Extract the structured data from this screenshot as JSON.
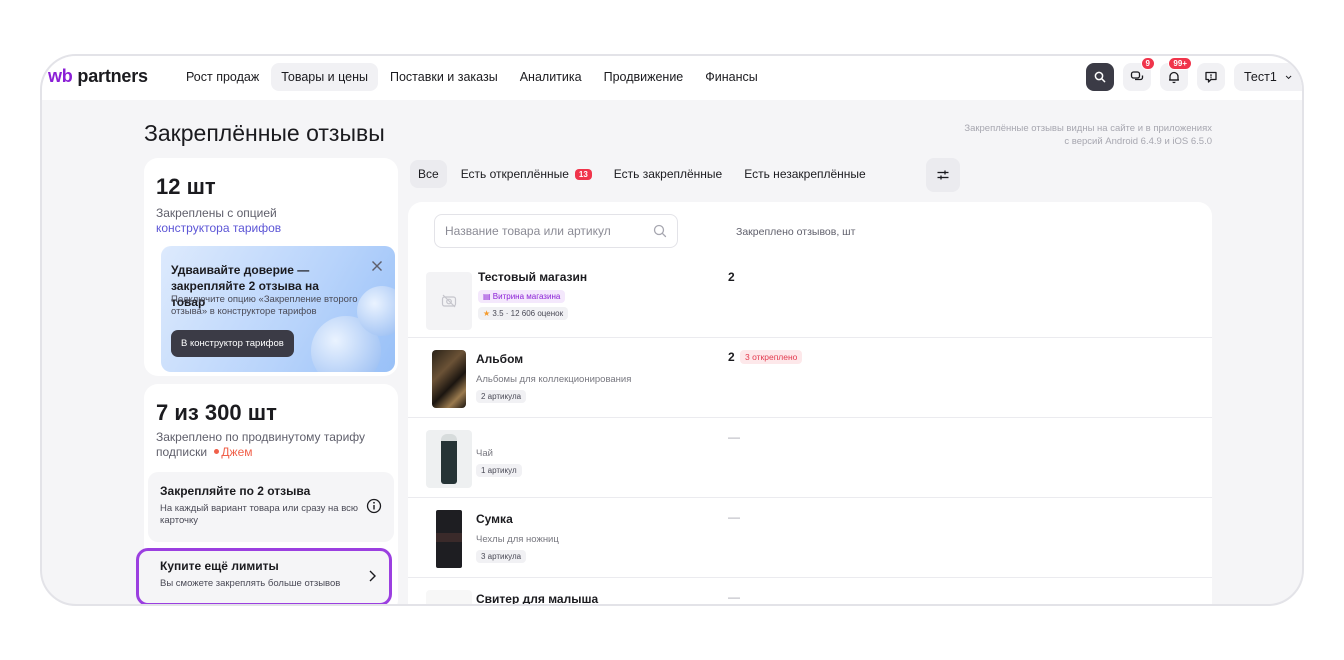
{
  "brand": {
    "prefix": "wb",
    "name": " partners"
  },
  "nav": [
    {
      "label": "Рост продаж"
    },
    {
      "label": "Товары и цены",
      "active": true
    },
    {
      "label": "Поставки и заказы"
    },
    {
      "label": "Аналитика"
    },
    {
      "label": "Продвижение"
    },
    {
      "label": "Финансы"
    }
  ],
  "header_actions": {
    "chat_badge": "9",
    "notifications_badge": "99+",
    "user_name": "Тест1"
  },
  "page": {
    "title": "Закреплённые отзывы",
    "note_line1": "Закреплённые отзывы видны на сайте и в приложениях",
    "note_line2": "с версий Android 6.4.9 и iOS 6.5.0"
  },
  "summary_card": {
    "count": "12 шт",
    "text": "Закреплены с опцией",
    "link": "конструктора тарифов"
  },
  "promo": {
    "title": "Удваивайте доверие — закрепляйте 2 отзыва на товар",
    "text": "Подключите опцию «Закрепление второго отзыва» в конструкторе тарифов",
    "button": "В конструктор тарифов"
  },
  "plan_card": {
    "count": "7 из 300 шт",
    "text": "Закреплено по продвинутому тарифу подписки",
    "plan_name": "Джем",
    "tip_title": "Закрепляйте по 2 отзыва",
    "tip_text": "На каждый вариант товара или сразу на всю карточку",
    "buy_title": "Купите ещё лимиты",
    "buy_text": "Вы сможете закреплять больше отзывов"
  },
  "filters": [
    {
      "label": "Все",
      "active": true
    },
    {
      "label": "Есть откреплённые",
      "badge": "13"
    },
    {
      "label": "Есть закреплённые"
    },
    {
      "label": "Есть незакреплённые"
    }
  ],
  "table": {
    "search_placeholder": "Название товара или артикул",
    "column_header": "Закреплено отзывов, шт",
    "rows": [
      {
        "name": "Тестовый магазин",
        "tag": "Витрина магазина",
        "rating": "3.5 · 12 606 оценок",
        "count": "2"
      },
      {
        "name": "Альбом",
        "sub": "Альбомы для коллекционирования",
        "tag": "2 артикула",
        "count": "2",
        "unpinned": "3 откреплено"
      },
      {
        "name": "",
        "sub": "Чай",
        "tag": "1 артикул",
        "count": "—"
      },
      {
        "name": "Сумка",
        "sub": "Чехлы для ножниц",
        "tag": "3 артикула",
        "count": "—"
      },
      {
        "name": "Свитер для малыша",
        "count": "—"
      }
    ]
  }
}
